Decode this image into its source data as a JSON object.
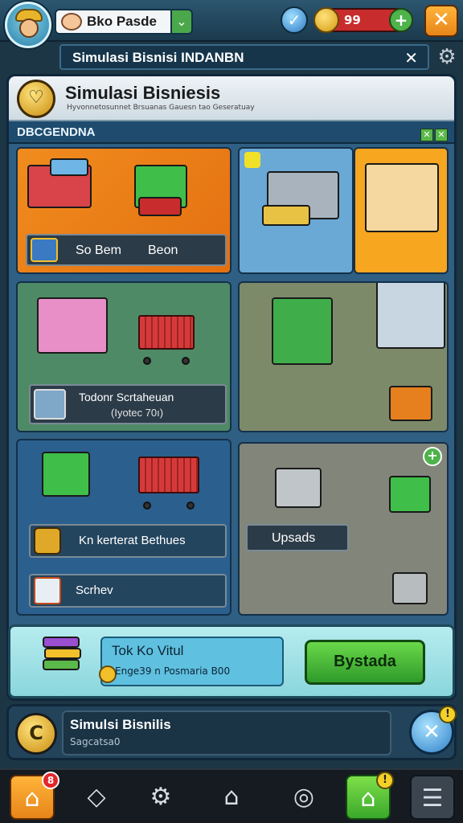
{
  "topbar": {
    "player_name": "Bko Pasde",
    "coins": "99"
  },
  "banner": {
    "title": "Simulasi Bisnisi INDANBN"
  },
  "panel": {
    "title": "Simulasi Bisniesis",
    "subtitle": "Hyvonnetosunnet Brsuanas Gauesn tao Geseratuay",
    "category": "DBCGENDNA"
  },
  "cards": {
    "card1_label": "So Bem",
    "card1_label2": "Beon",
    "card4_line1": "Todonr Scrtaheuan",
    "card4_line2": "(Iyotec 70ı)",
    "card6_label": "Kn kerterat Bethues",
    "card6_label2": "Scrhev",
    "card7_label": "Upsads"
  },
  "promo": {
    "title": "Tok Ko Vitul",
    "subtitle": "Enge39 n Posmaria B00",
    "button": "Bystada"
  },
  "status": {
    "title": "Simulsi Bisnilis",
    "subtitle": "Sagcatsa0",
    "tool_badge": "!"
  },
  "nav": {
    "home_badge": "8",
    "home2_badge": "!"
  },
  "colors": {
    "accent_orange": "#e7851a",
    "accent_green": "#3aa82a",
    "panel_blue": "#2f5f82"
  }
}
